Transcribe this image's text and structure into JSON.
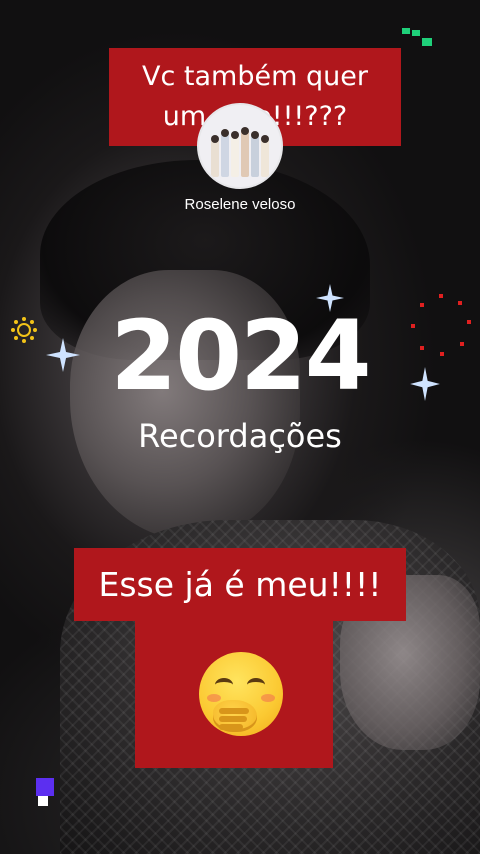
{
  "post": {
    "top_caption_line1": "Vc também quer",
    "top_caption_line2": "um c      no!!!???",
    "username": "Roselene veloso",
    "headline_year": "2024",
    "headline_subtitle": "Recordações",
    "bottom_caption": "Esse já é meu!!!!"
  },
  "icons": {
    "avatar": "profile-avatar",
    "emoji": "face-with-hand-over-mouth",
    "sparkles": "sparkle-icon",
    "fireworks": "firework-icon"
  },
  "colors": {
    "caption_band": "#b0171c",
    "text": "#ffffff",
    "sparkle": "#cfe3ff",
    "firework_red": "#e02020",
    "firework_yellow": "#f2c318",
    "pixel_green": "#1fd07a",
    "pixel_purple": "#5c2ff0"
  }
}
